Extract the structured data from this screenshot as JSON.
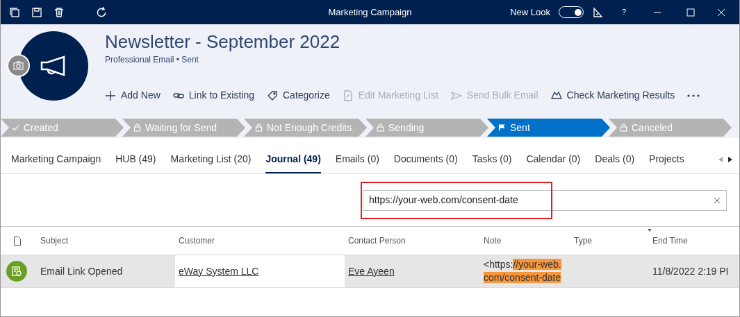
{
  "window": {
    "title": "Marketing Campaign",
    "new_look": {
      "label": "New Look",
      "on": true
    },
    "help": "?"
  },
  "record": {
    "title": "Newsletter - September 2022",
    "subtitle": "Professional Email • Sent"
  },
  "actions": [
    {
      "label": "Add New",
      "kind": "plus",
      "disabled": false
    },
    {
      "label": "Link to Existing",
      "kind": "link",
      "disabled": false
    },
    {
      "label": "Categorize",
      "kind": "tag",
      "disabled": false
    },
    {
      "label": "Edit Marketing List",
      "kind": "doc",
      "disabled": true
    },
    {
      "label": "Send Bulk Email",
      "kind": "send",
      "disabled": true
    },
    {
      "label": "Check Marketing Results",
      "kind": "chart",
      "disabled": false
    }
  ],
  "stages": [
    {
      "label": "Created",
      "kind": "done",
      "selected": false
    },
    {
      "label": "Waiting for Send",
      "kind": "locked",
      "selected": false
    },
    {
      "label": "Not Enough Credits",
      "kind": "locked",
      "selected": false
    },
    {
      "label": "Sending",
      "kind": "locked",
      "selected": false
    },
    {
      "label": "Sent",
      "kind": "current",
      "selected": true
    },
    {
      "label": "Canceled",
      "kind": "locked",
      "selected": false
    }
  ],
  "tabs": [
    {
      "label": "Marketing Campaign",
      "selected": false
    },
    {
      "label": "HUB (49)",
      "selected": false
    },
    {
      "label": "Marketing List (20)",
      "selected": false
    },
    {
      "label": "Journal (49)",
      "selected": true
    },
    {
      "label": "Emails (0)",
      "selected": false
    },
    {
      "label": "Documents (0)",
      "selected": false
    },
    {
      "label": "Tasks (0)",
      "selected": false
    },
    {
      "label": "Calendar (0)",
      "selected": false
    },
    {
      "label": "Deals (0)",
      "selected": false
    },
    {
      "label": "Projects",
      "selected": false
    }
  ],
  "search": {
    "value": "https://your-web.com/consent-date",
    "outlined": true
  },
  "table": {
    "columns": [
      "Subject",
      "Customer",
      "Contact Person",
      "Note",
      "Type",
      "End Time"
    ],
    "rows": [
      {
        "subject": "Email Link Opened",
        "customer": "eWay System LLC",
        "contact": "Eve Ayeen",
        "note": [
          {
            "text": "<https:",
            "highlighted": false
          },
          {
            "text": "//your-web.com/consent-date",
            "highlighted": true
          }
        ],
        "type": "",
        "end_time": "11/8/2022 2:19 PI"
      }
    ]
  }
}
